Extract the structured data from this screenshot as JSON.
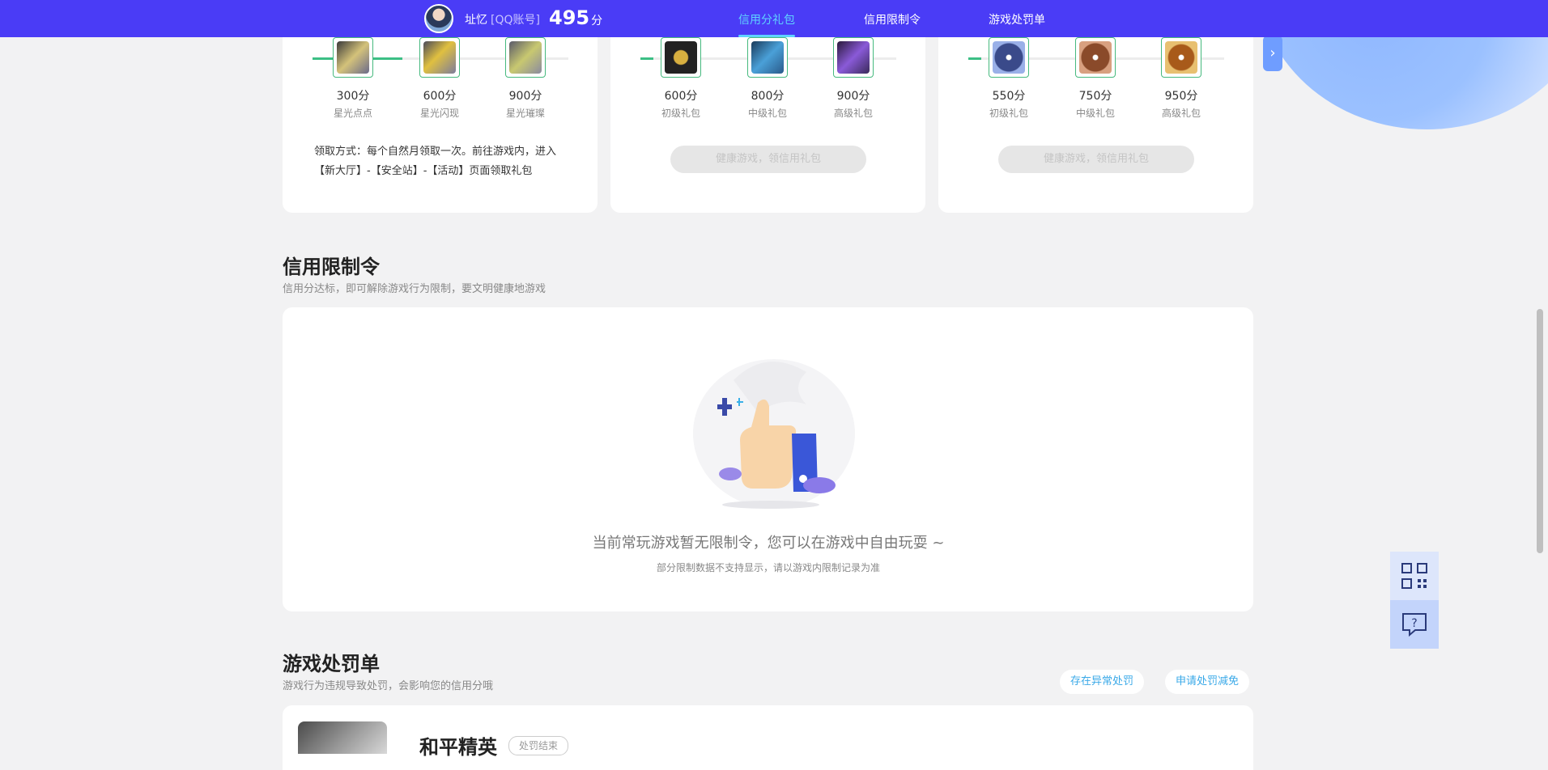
{
  "header": {
    "username": "址忆",
    "account_type": "[QQ账号]",
    "score": "495",
    "score_unit": "分",
    "tabs": [
      {
        "label": "信用分礼包",
        "active": true
      },
      {
        "label": "信用限制令",
        "active": false
      },
      {
        "label": "游戏处罚单",
        "active": false
      }
    ]
  },
  "gift_cards": [
    {
      "progress_fraction": 0.35,
      "items": [
        {
          "points": "300分",
          "name": "星光点点"
        },
        {
          "points": "600分",
          "name": "星光闪现"
        },
        {
          "points": "900分",
          "name": "星光璀璨"
        }
      ],
      "claim_note": "领取方式：每个自然月领取一次。前往游戏内，进入【新大厅】-【安全站】-【活动】页面领取礼包"
    },
    {
      "progress_fraction": 0.05,
      "items": [
        {
          "points": "600分",
          "name": "初级礼包"
        },
        {
          "points": "800分",
          "name": "中级礼包"
        },
        {
          "points": "900分",
          "name": "高级礼包"
        }
      ],
      "button_label": "健康游戏，领信用礼包"
    },
    {
      "progress_fraction": 0.05,
      "items": [
        {
          "points": "550分",
          "name": "初级礼包"
        },
        {
          "points": "750分",
          "name": "中级礼包"
        },
        {
          "points": "950分",
          "name": "高级礼包"
        }
      ],
      "button_label": "健康游戏，领信用礼包"
    }
  ],
  "restriction": {
    "title": "信用限制令",
    "subtitle": "信用分达标，即可解除游戏行为限制，要文明健康地游戏",
    "empty_message": "当前常玩游戏暂无限制令，您可以在游戏中自由玩耍 ~",
    "empty_note": "部分限制数据不支持显示，请以游戏内限制记录为准"
  },
  "penalty": {
    "title": "游戏处罚单",
    "subtitle": "游戏行为违规导致处罚，会影响您的信用分哦",
    "abnormal_button": "存在异常处罚",
    "appeal_button": "申请处罚减免",
    "first_item": {
      "game": "和平精英",
      "status": "处罚结束"
    }
  },
  "colors": {
    "brand_bar": "#4a3cf6",
    "active_tab": "#5fd3ff",
    "progress": "#3cbf85",
    "link": "#3aa9e8"
  },
  "icons": {
    "next": "chevron-right-icon",
    "qr": "qr-code-icon",
    "help": "help-chat-icon",
    "empty_state": "thumbs-up-illustration"
  }
}
